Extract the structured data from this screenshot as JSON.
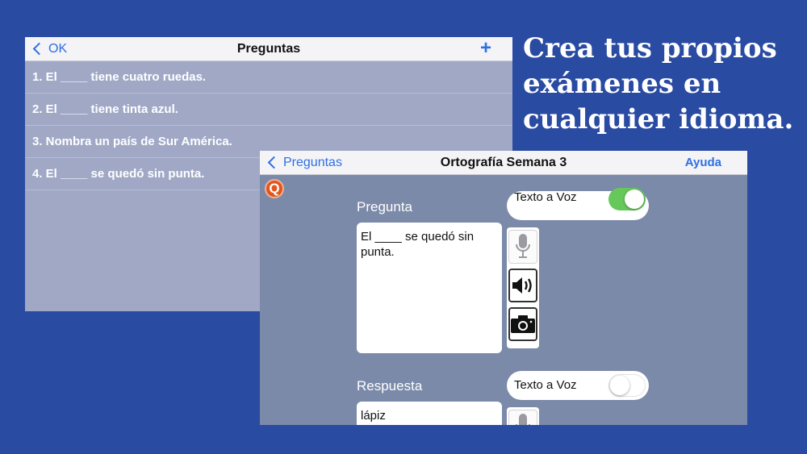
{
  "list_panel": {
    "back_label": "OK",
    "title": "Preguntas",
    "add_label": "+",
    "questions": [
      "1. El ____ tiene cuatro ruedas.",
      "2. El ____ tiene tinta azul.",
      "3. Nombra un país de Sur América.",
      "4. El ____ se quedó sin punta."
    ]
  },
  "headline": "Crea tus propios exámenes en cualquier idioma.",
  "editor": {
    "back_label": "Preguntas",
    "title": "Ortografía Semana 3",
    "help_label": "Ayuda",
    "logo_letter": "Q",
    "question": {
      "label": "Pregunta",
      "tts_label": "Texto a Voz",
      "tts_enabled": true,
      "text": "El ____ se quedó sin punta."
    },
    "answer": {
      "label": "Respuesta",
      "tts_label": "Texto a Voz",
      "tts_enabled": false,
      "text": "lápiz"
    }
  },
  "colors": {
    "background": "#2a4ba2",
    "accent": "#2f6fe3",
    "switch_on": "#66c85a",
    "logo": "#e2561e"
  },
  "icons": [
    "chevron-left-icon",
    "plus-icon",
    "microphone-icon",
    "speaker-icon",
    "camera-icon"
  ]
}
